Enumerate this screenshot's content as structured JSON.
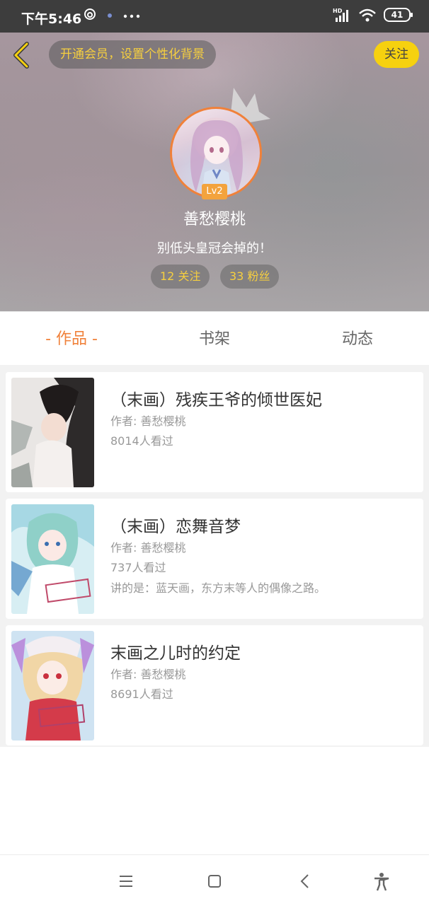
{
  "status_bar": {
    "time": "下午5:46",
    "battery": "41",
    "network": "HD"
  },
  "header": {
    "vip_prompt": "开通会员，设置个性化背景",
    "follow_label": "关注",
    "level": "Lv2",
    "username": "善愁樱桃",
    "bio": "别低头皇冠会掉的！",
    "following": "12 关注",
    "followers": "33 粉丝"
  },
  "tabs": [
    {
      "label": "- 作品 -",
      "active": true
    },
    {
      "label": "书架",
      "active": false
    },
    {
      "label": "动态",
      "active": false
    }
  ],
  "works": [
    {
      "title": "（末画）残疾王爷的倾世医妃",
      "author": "作者: 善愁樱桃",
      "views": "8014人看过",
      "desc": ""
    },
    {
      "title": "（末画）恋舞音梦",
      "author": "作者: 善愁樱桃",
      "views": "737人看过",
      "desc": "讲的是：蓝天画，东方末等人的偶像之路。"
    },
    {
      "title": "末画之儿时的约定",
      "author": "作者: 善愁樱桃",
      "views": "8691人看过",
      "desc": ""
    }
  ],
  "colors": {
    "accent": "#f0813a",
    "yellow": "#f6d10f",
    "stat_text": "#f6cf3f"
  },
  "icons": [
    "back-chevron-icon",
    "crown-icon",
    "menu-icon",
    "home-icon",
    "back-icon",
    "accessibility-icon"
  ]
}
